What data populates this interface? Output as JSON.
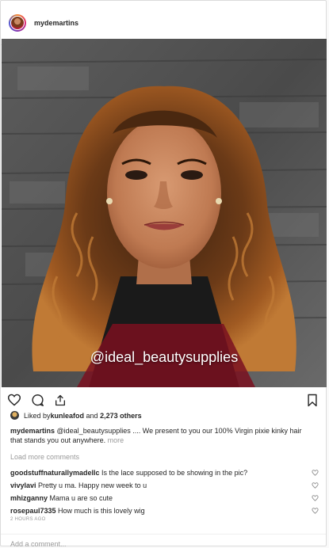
{
  "header": {
    "username": "mydemartins"
  },
  "post": {
    "watermark": "@ideal_beautysupplies",
    "likes": {
      "liker": "kunleafod",
      "middle": " and ",
      "count_text": "2,273 others",
      "prefix": "Liked by "
    },
    "caption": {
      "username": "mydemartins",
      "text": " @ideal_beautysupplies .... We present to you our 100% Virgin pixie kinky hair that stands you out anywhere.",
      "more": "more"
    },
    "load_more": "Load more comments",
    "comments": [
      {
        "user": "goodstuffnaturallymadellc",
        "text": " Is the lace supposed to be showing in the pic?"
      },
      {
        "user": "vivylavi",
        "text": " Pretty u ma. Happy new week to u"
      },
      {
        "user": "mhizganny",
        "text": " Mama u are so cute"
      },
      {
        "user": "rosepaul7335",
        "text": " How much is this lovely wig"
      }
    ],
    "timestamp": "2 HOURS AGO",
    "add_comment_placeholder": "Add a comment..."
  },
  "icons": [
    "heart-icon",
    "comment-icon",
    "share-icon",
    "bookmark-icon"
  ]
}
